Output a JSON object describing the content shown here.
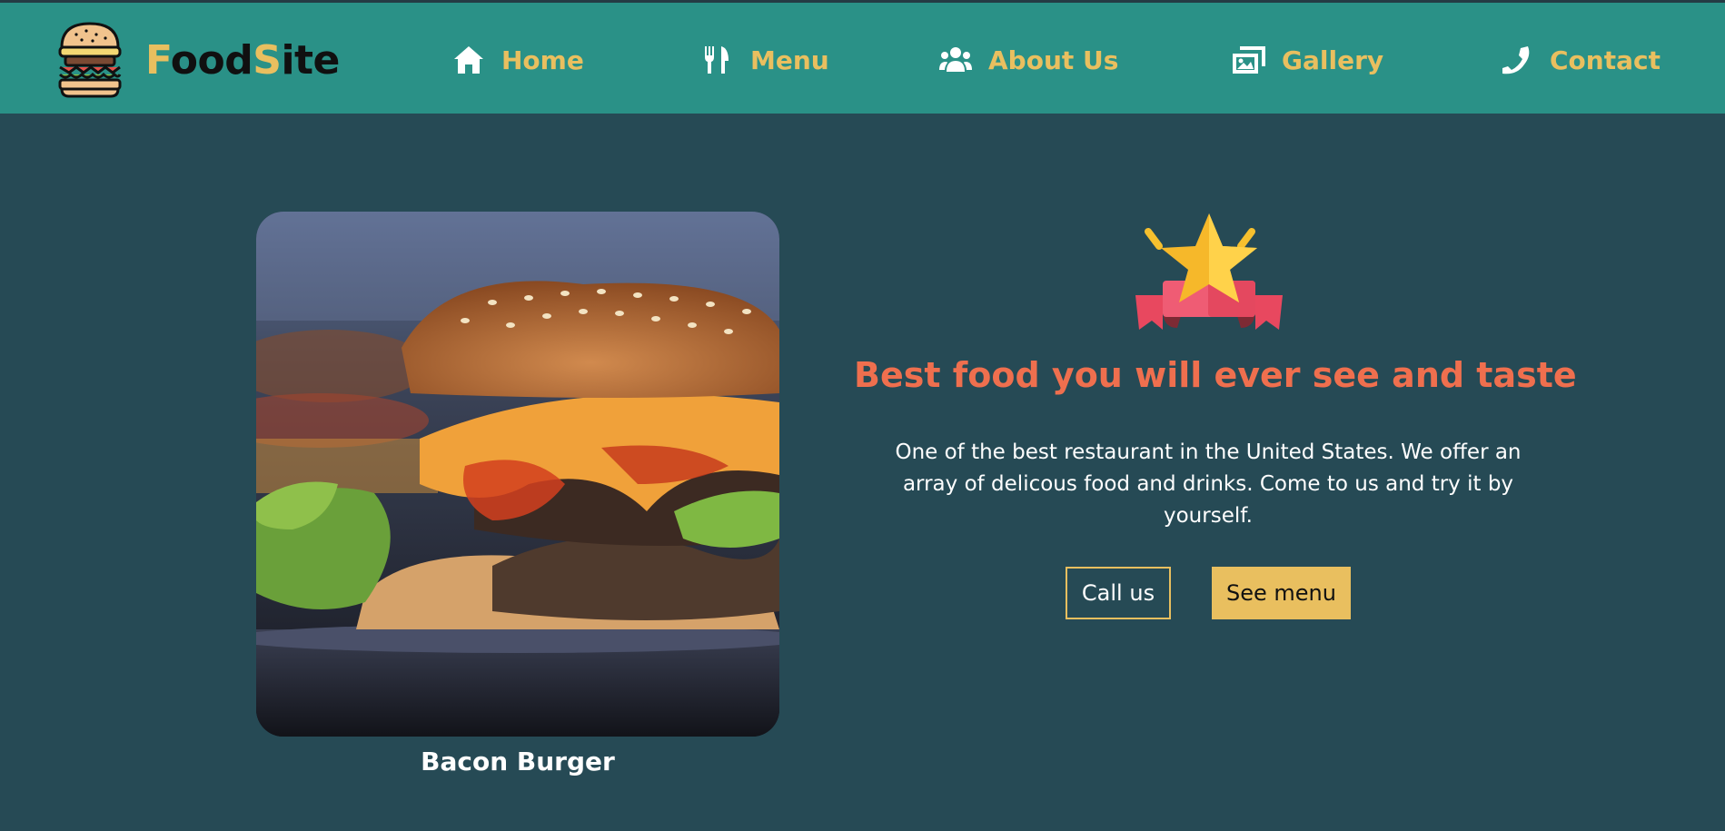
{
  "brand": {
    "part1": "F",
    "part2": "ood",
    "part3": "S",
    "part4": "ite"
  },
  "nav": [
    {
      "label": "Home",
      "icon": "home-icon"
    },
    {
      "label": "Menu",
      "icon": "fork-knife-icon"
    },
    {
      "label": "About Us",
      "icon": "users-icon"
    },
    {
      "label": "Gallery",
      "icon": "images-icon"
    },
    {
      "label": "Contact",
      "icon": "phone-icon"
    }
  ],
  "hero": {
    "headline": "Best food you will ever see and taste",
    "description": "One of the best restaurant in the United States. We offer an array of delicous food and drinks. Come to us and try it by yourself.",
    "call_button": "Call us",
    "menu_button": "See menu",
    "badge_icon": "star-ribbon-award-icon"
  },
  "featured": {
    "caption": "Bacon Burger",
    "image": "burger-photo"
  },
  "colors": {
    "header_bg": "#2a9187",
    "page_bg": "#264a55",
    "accent": "#e9bf5f",
    "headline": "#ef6f4e"
  }
}
